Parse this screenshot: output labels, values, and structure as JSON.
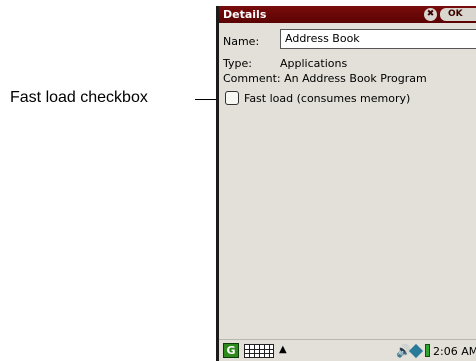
{
  "callout": {
    "label": "Fast load checkbox"
  },
  "window": {
    "title": "Details",
    "close_symbol": "✖",
    "ok_label": "OK"
  },
  "form": {
    "name_label": "Name:",
    "name_value": "Address Book",
    "type_label": "Type:",
    "type_value": "Applications",
    "comment_text": "Comment: An Address Book Program",
    "fast_load_label": "Fast load (consumes memory)",
    "fast_load_checked": false
  },
  "taskbar": {
    "start_symbol": "G",
    "arrow_symbol": "▲",
    "speaker_symbol": "🔊",
    "clock": "2:06 AM"
  },
  "icons": {
    "start": "start-menu-icon",
    "keyboard": "keyboard-icon",
    "speaker": "speaker-icon",
    "network": "network-icon",
    "battery": "battery-icon"
  },
  "colors": {
    "titlebar": "#6a0707",
    "background": "#e2e0d8"
  }
}
